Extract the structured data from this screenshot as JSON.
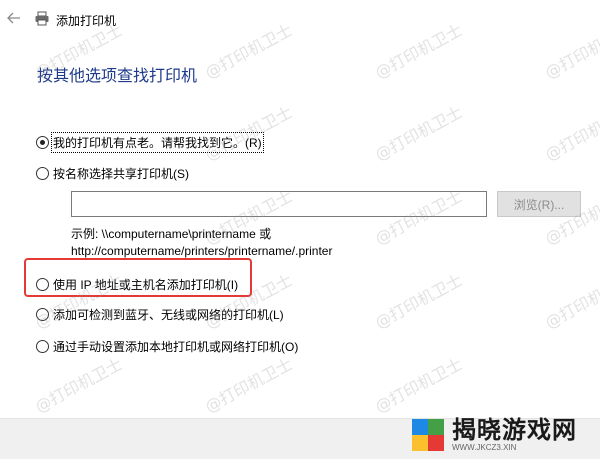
{
  "window": {
    "title": "添加打印机"
  },
  "heading": "按其他选项查找打印机",
  "options": [
    {
      "label": "我的打印机有点老。请帮我找到它。(R)",
      "selected": true
    },
    {
      "label": "按名称选择共享打印机(S)",
      "selected": false
    },
    {
      "label": "使用 IP 地址或主机名添加打印机(I)",
      "selected": false
    },
    {
      "label": "添加可检测到蓝牙、无线或网络的打印机(L)",
      "selected": false
    },
    {
      "label": "通过手动设置添加本地打印机或网络打印机(O)",
      "selected": false
    }
  ],
  "shared": {
    "value": "",
    "browse_label": "浏览(R)...",
    "example_line1": "示例: \\\\computername\\printername 或",
    "example_line2": "http://computername/printers/printername/.printer"
  },
  "watermark": "@打印机卫士",
  "logo": {
    "name": "揭晓游戏网",
    "url": "WWW.JKCZ3.XIN"
  },
  "colors": {
    "heading": "#1e3a8a",
    "highlight": "#e53935"
  }
}
